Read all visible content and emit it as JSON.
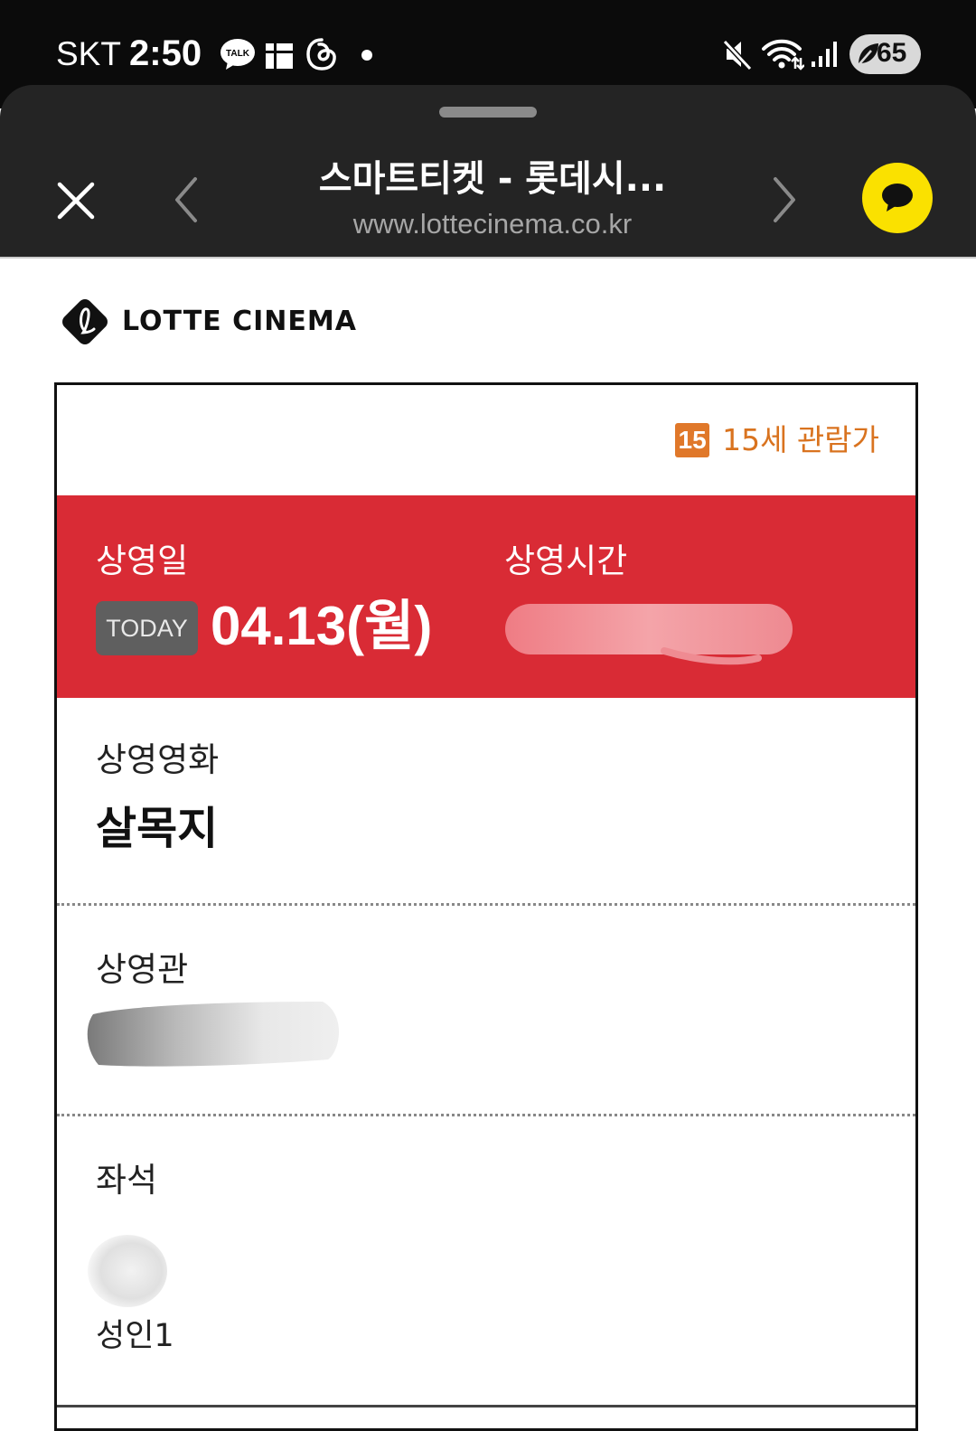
{
  "status_bar": {
    "carrier": "SKT",
    "time": "2:50",
    "notification_icons": [
      "kakaotalk-icon",
      "calendar-widget-icon",
      "threads-icon",
      "dot-icon"
    ],
    "right_icons": [
      "mute-icon",
      "wifi-icon",
      "signal-icon"
    ],
    "battery": "65"
  },
  "browser": {
    "title": "스마트티켓 - 롯데시...",
    "url": "www.lottecinema.co.kr",
    "close_icon": "close-icon",
    "back_icon": "chevron-left-icon",
    "forward_icon": "chevron-right-icon",
    "share_icon": "kakao-chat-icon",
    "accent_color": "#fae100"
  },
  "brand": {
    "logo_text": "LOTTE CINEMA"
  },
  "ticket": {
    "rating_badge": "15",
    "rating_text": "15세 관람가",
    "rating_color": "#e0782a",
    "band_color": "#d92b35",
    "date_label": "상영일",
    "today_badge": "TODAY",
    "date_value": "04.13(월)",
    "time_label": "상영시간",
    "movie_label": "상영영화",
    "movie_title": "살목지",
    "theater_label": "상영관",
    "seat_label": "좌석",
    "seat_type": "성인1"
  }
}
